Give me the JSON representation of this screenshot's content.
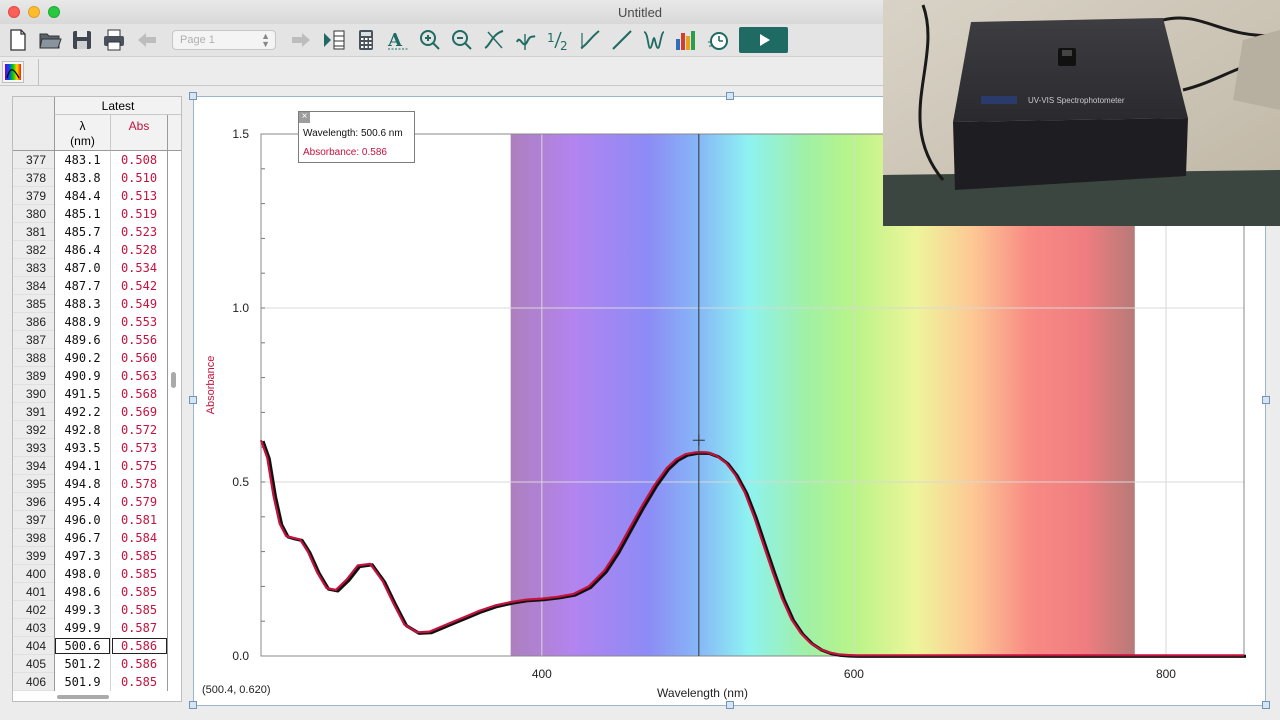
{
  "window": {
    "title": "Untitled"
  },
  "toolbar": {
    "page_select": "Page 1",
    "icons": [
      "new-file",
      "open-folder",
      "save",
      "print",
      "back-arrow",
      "page-select",
      "forward-arrow",
      "data-browser",
      "calculator",
      "text-annotation",
      "zoom-in",
      "zoom-out",
      "tangent",
      "integral",
      "statistics",
      "curve-fit",
      "linear-fit",
      "peak",
      "bar-graph",
      "stopwatch",
      "collect"
    ]
  },
  "table": {
    "group_header": "Latest",
    "col1_symbol": "λ",
    "col1_unit": "(nm)",
    "col2_label": "Abs",
    "selected_row": "404",
    "rows": [
      [
        "377",
        "483.1",
        "0.508"
      ],
      [
        "378",
        "483.8",
        "0.510"
      ],
      [
        "379",
        "484.4",
        "0.513"
      ],
      [
        "380",
        "485.1",
        "0.519"
      ],
      [
        "381",
        "485.7",
        "0.523"
      ],
      [
        "382",
        "486.4",
        "0.528"
      ],
      [
        "383",
        "487.0",
        "0.534"
      ],
      [
        "384",
        "487.7",
        "0.542"
      ],
      [
        "385",
        "488.3",
        "0.549"
      ],
      [
        "386",
        "488.9",
        "0.553"
      ],
      [
        "387",
        "489.6",
        "0.556"
      ],
      [
        "388",
        "490.2",
        "0.560"
      ],
      [
        "389",
        "490.9",
        "0.563"
      ],
      [
        "390",
        "491.5",
        "0.568"
      ],
      [
        "391",
        "492.2",
        "0.569"
      ],
      [
        "392",
        "492.8",
        "0.572"
      ],
      [
        "393",
        "493.5",
        "0.573"
      ],
      [
        "394",
        "494.1",
        "0.575"
      ],
      [
        "395",
        "494.8",
        "0.578"
      ],
      [
        "396",
        "495.4",
        "0.579"
      ],
      [
        "397",
        "496.0",
        "0.581"
      ],
      [
        "398",
        "496.7",
        "0.584"
      ],
      [
        "399",
        "497.3",
        "0.585"
      ],
      [
        "400",
        "498.0",
        "0.585"
      ],
      [
        "401",
        "498.6",
        "0.585"
      ],
      [
        "402",
        "499.3",
        "0.585"
      ],
      [
        "403",
        "499.9",
        "0.587"
      ],
      [
        "404",
        "500.6",
        "0.586"
      ],
      [
        "405",
        "501.2",
        "0.586"
      ],
      [
        "406",
        "501.9",
        "0.585"
      ]
    ]
  },
  "tooltip": {
    "wavelength_text": "Wavelength: 500.6 nm",
    "absorbance_text": "Absorbance: 0.586"
  },
  "coordinate_readout": "(500.4, 0.620)",
  "colors": {
    "absorbance_red": "#c4123f",
    "curve_black": "#111111",
    "play_button": "#1f6b63"
  },
  "device_label": "UV-VIS Spectrophotometer",
  "chart_data": {
    "type": "line",
    "xlabel": "Wavelength (nm)",
    "ylabel": "Absorbance",
    "xlim": [
      220,
      850
    ],
    "ylim": [
      0,
      1.5
    ],
    "x_ticks": [
      400,
      600,
      800
    ],
    "y_ticks": [
      0.0,
      0.5,
      1.0,
      1.5
    ],
    "y_tick_labels": [
      "0.0",
      "0.5",
      "1.0",
      "1.5"
    ],
    "grid": true,
    "visible_spectrum_band_nm": [
      380,
      780
    ],
    "cursor_x": 500.6,
    "series": [
      {
        "color": "#c4123f",
        "x": [
          220,
          224,
          228,
          232,
          236,
          240,
          245,
          250,
          256,
          262,
          268,
          275,
          282,
          290,
          298,
          305,
          312,
          320,
          328,
          336,
          344,
          352,
          360,
          370,
          380,
          390,
          400,
          410,
          420,
          430,
          440,
          448,
          456,
          464,
          472,
          480,
          486,
          492,
          498,
          502,
          506,
          512,
          518,
          524,
          530,
          536,
          542,
          548,
          554,
          560,
          566,
          572,
          578,
          584,
          590,
          596,
          602,
          610,
          620,
          640,
          680,
          720,
          760,
          800,
          850
        ],
        "y": [
          0.62,
          0.57,
          0.46,
          0.38,
          0.345,
          0.34,
          0.335,
          0.3,
          0.24,
          0.195,
          0.19,
          0.22,
          0.26,
          0.265,
          0.215,
          0.15,
          0.09,
          0.068,
          0.07,
          0.085,
          0.1,
          0.115,
          0.13,
          0.145,
          0.155,
          0.162,
          0.165,
          0.17,
          0.178,
          0.2,
          0.245,
          0.3,
          0.365,
          0.43,
          0.49,
          0.54,
          0.565,
          0.58,
          0.585,
          0.586,
          0.585,
          0.575,
          0.555,
          0.52,
          0.47,
          0.4,
          0.32,
          0.24,
          0.165,
          0.105,
          0.065,
          0.038,
          0.02,
          0.01,
          0.005,
          0.003,
          0.002,
          0.002,
          0.002,
          0.002,
          0.002,
          0.002,
          0.002,
          0.002,
          0.002
        ]
      }
    ]
  }
}
